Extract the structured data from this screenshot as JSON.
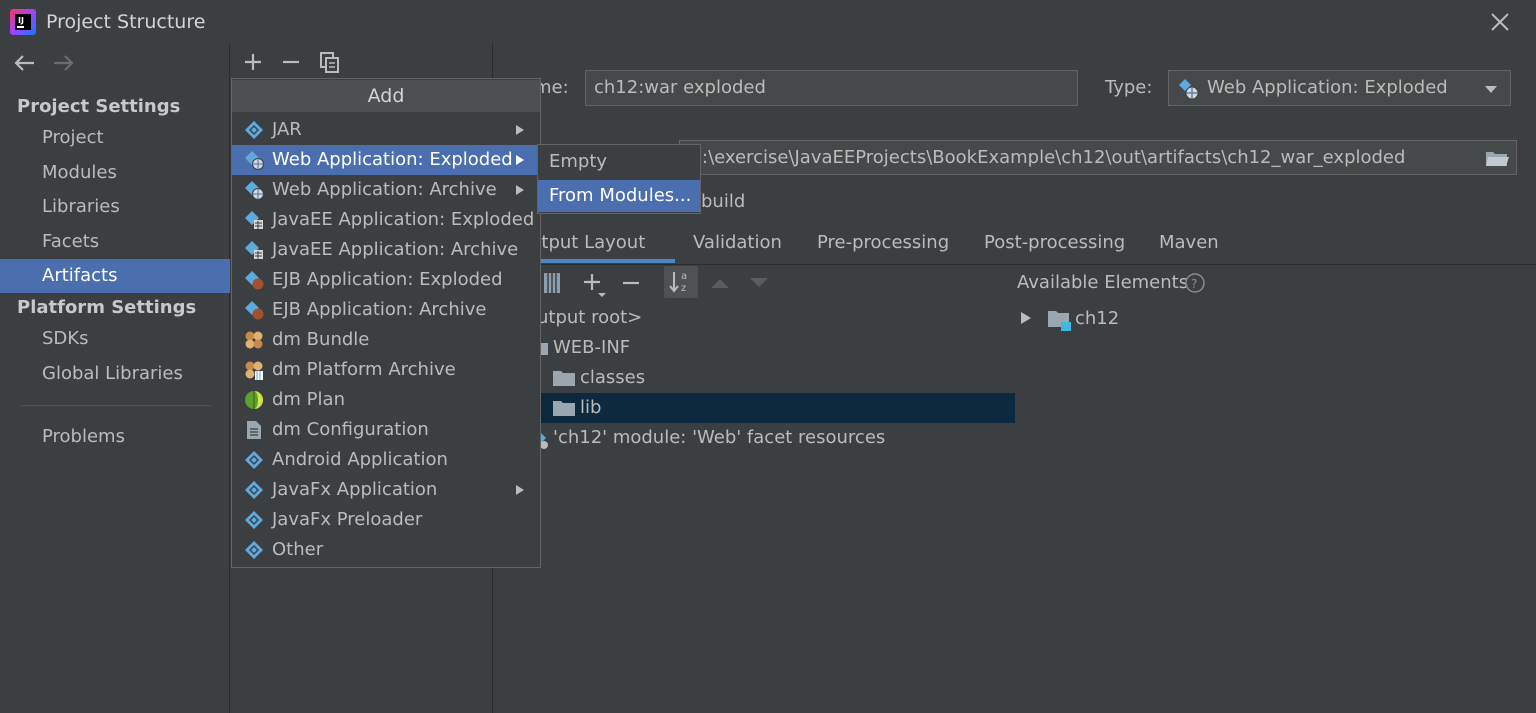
{
  "window": {
    "title": "Project Structure"
  },
  "sidebar": {
    "project_settings_header": "Project Settings",
    "project_items": [
      "Project",
      "Modules",
      "Libraries",
      "Facets",
      "Artifacts"
    ],
    "selected": "Artifacts",
    "platform_settings_header": "Platform Settings",
    "platform_items": [
      "SDKs",
      "Global Libraries"
    ],
    "problems": "Problems"
  },
  "artifact": {
    "name_label": "me:",
    "name_value": "ch12:war exploded",
    "type_label": "Type:",
    "type_value": "Web Application: Exploded",
    "output_path": ":\\exercise\\JavaEEProjects\\BookExample\\ch12\\out\\artifacts\\ch12_war_exploded",
    "build_fragment": "build"
  },
  "tabs": [
    "utput Layout",
    "Validation",
    "Pre-processing",
    "Post-processing",
    "Maven"
  ],
  "layout_tree": {
    "items": [
      "utput root>",
      "WEB-INF",
      "classes",
      "lib",
      "'ch12' module: 'Web' facet resources"
    ],
    "selected": "lib"
  },
  "available_elements": {
    "title": "Available Elements",
    "items": [
      "ch12"
    ]
  },
  "add_menu": {
    "title": "Add",
    "items": [
      {
        "label": "JAR",
        "icon": "diamond-icon",
        "submenu": true
      },
      {
        "label": "Web Application: Exploded",
        "icon": "web-diamond-icon",
        "submenu": true,
        "selected": true
      },
      {
        "label": "Web Application: Archive",
        "icon": "web-diamond-icon",
        "submenu": true
      },
      {
        "label": "JavaEE Application: Exploded",
        "icon": "javaee-icon",
        "submenu": false
      },
      {
        "label": "JavaEE Application: Archive",
        "icon": "javaee-icon",
        "submenu": false
      },
      {
        "label": "EJB Application: Exploded",
        "icon": "ejb-icon",
        "submenu": false
      },
      {
        "label": "EJB Application: Archive",
        "icon": "ejb-icon",
        "submenu": false
      },
      {
        "label": "dm Bundle",
        "icon": "bundle-icon",
        "submenu": false
      },
      {
        "label": "dm Platform Archive",
        "icon": "bundle-archive-icon",
        "submenu": false
      },
      {
        "label": "dm Plan",
        "icon": "plan-icon",
        "submenu": false
      },
      {
        "label": "dm Configuration",
        "icon": "config-file-icon",
        "submenu": false
      },
      {
        "label": "Android Application",
        "icon": "diamond-icon",
        "submenu": false
      },
      {
        "label": "JavaFx Application",
        "icon": "diamond-icon",
        "submenu": true
      },
      {
        "label": "JavaFx Preloader",
        "icon": "diamond-icon",
        "submenu": false
      },
      {
        "label": "Other",
        "icon": "diamond-icon",
        "submenu": false
      }
    ]
  },
  "submenu": {
    "items": [
      "Empty",
      "From Modules..."
    ],
    "selected": "From Modules..."
  },
  "colors": {
    "background": "#3c3f41",
    "selection": "#4b6eaf",
    "tree_selection": "#0d293e",
    "text": "#bbbbbb"
  }
}
